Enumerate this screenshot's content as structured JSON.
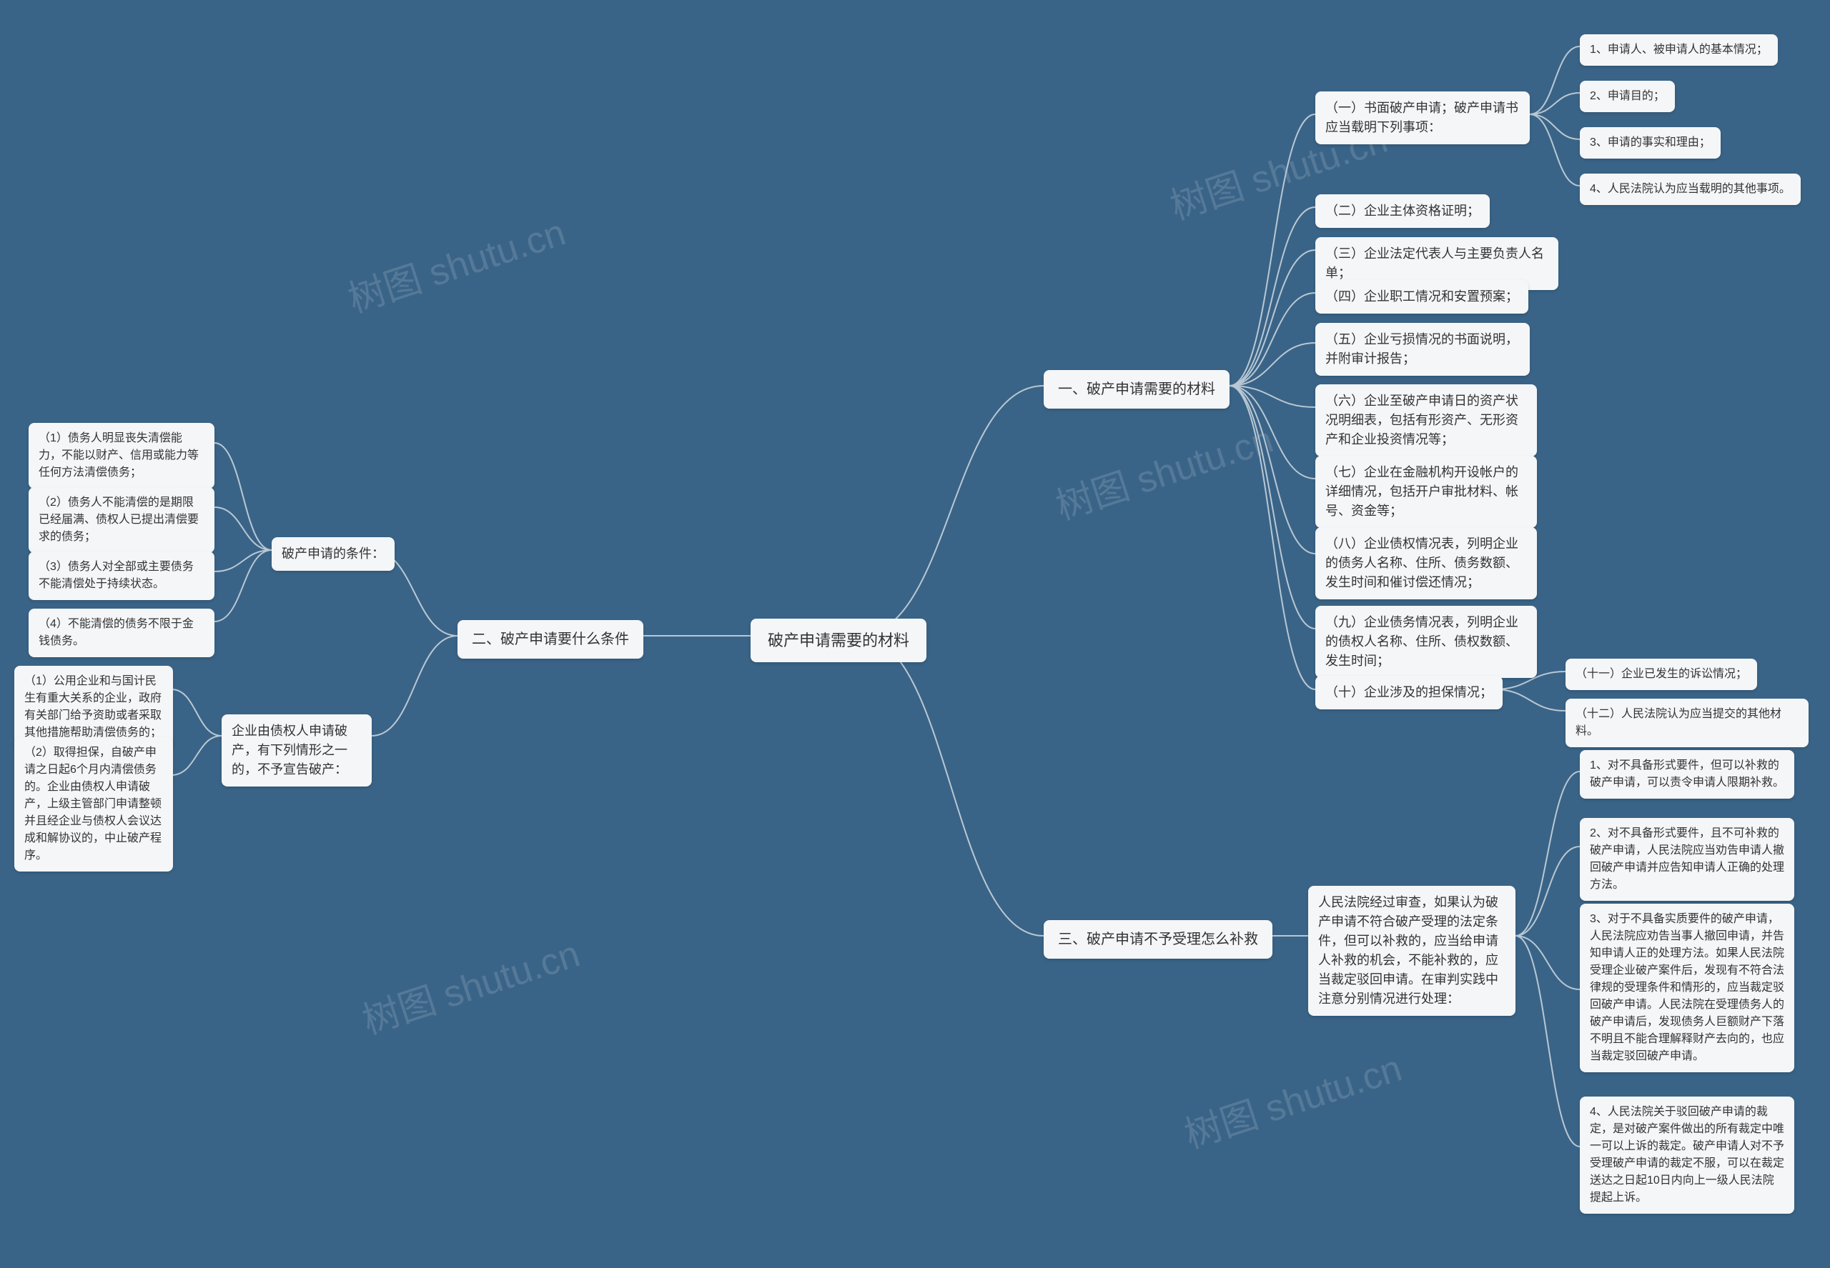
{
  "watermark": "树图 shutu.cn",
  "center": "破产申请需要的材料",
  "branch1": {
    "title": "一、破产申请需要的材料",
    "n1": "（一）书面破产申请；破产申请书应当载明下列事项：",
    "n1_1": "1、申请人、被申请人的基本情况；",
    "n1_2": "2、申请目的；",
    "n1_3": "3、申请的事实和理由；",
    "n1_4": "4、人民法院认为应当载明的其他事项。",
    "n2": "（二）企业主体资格证明；",
    "n3": "（三）企业法定代表人与主要负责人名单；",
    "n4": "（四）企业职工情况和安置预案；",
    "n5": "（五）企业亏损情况的书面说明，并附审计报告；",
    "n6": "（六）企业至破产申请日的资产状况明细表，包括有形资产、无形资产和企业投资情况等；",
    "n7": "（七）企业在金融机构开设帐户的详细情况，包括开户审批材料、帐号、资金等；",
    "n8": "（八）企业债权情况表，列明企业的债务人名称、住所、债务数额、发生时间和催讨偿还情况；",
    "n9": "（九）企业债务情况表，列明企业的债权人名称、住所、债权数额、发生时间；",
    "n10": "（十）企业涉及的担保情况；",
    "n10_1": "（十一）企业已发生的诉讼情况；",
    "n10_2": "（十二）人民法院认为应当提交的其他材料。"
  },
  "branch2": {
    "title": "二、破产申请要什么条件",
    "sub1": "破产申请的条件：",
    "s1_1": "（1）债务人明显丧失清偿能力，不能以财产、信用或能力等任何方法清偿债务；",
    "s1_2": "（2）债务人不能清偿的是期限已经届满、债权人已提出清偿要求的债务；",
    "s1_3": "（3）债务人对全部或主要债务不能清偿处于持续状态。",
    "s1_4": "（4）不能清偿的债务不限于金钱债务。",
    "sub2": "企业由债权人申请破产，有下列情形之一的，不予宣告破产：",
    "s2_1": "（1）公用企业和与国计民生有重大关系的企业，政府有关部门给予资助或者采取其他措施帮助清偿债务的；",
    "s2_2": "（2）取得担保，自破产申请之日起6个月内清偿债务的。企业由债权人申请破产，上级主管部门申请整顿并且经企业与债权人会议达成和解协议的，中止破产程序。"
  },
  "branch3": {
    "title": "三、破产申请不予受理怎么补救",
    "intro": "人民法院经过审查，如果认为破产申请不符合破产受理的法定条件，但可以补救的，应当给申请人补救的机会，不能补救的，应当裁定驳回申请。在审判实践中注意分别情况进行处理：",
    "r1": "1、对不具备形式要件，但可以补救的破产申请，可以责令申请人限期补救。",
    "r2": "2、对不具备形式要件，且不可补救的破产申请，人民法院应当劝告申请人撤回破产申请并应告知申请人正确的处理方法。",
    "r3": "3、对于不具备实质要件的破产申请，人民法院应劝告当事人撤回申请，并告知申请人正的处理方法。如果人民法院受理企业破产案件后，发现有不符合法律规的受理条件和情形的，应当裁定驳回破产申请。人民法院在受理债务人的破产申请后，发现债务人巨额财产下落不明且不能合理解释财产去向的，也应当裁定驳回破产申请。",
    "r4": "4、人民法院关于驳回破产申请的裁定，是对破产案件做出的所有裁定中唯一可以上诉的裁定。破产申请人对不予受理破产申请的裁定不服，可以在裁定送达之日起10日内向上一级人民法院提起上诉。"
  }
}
